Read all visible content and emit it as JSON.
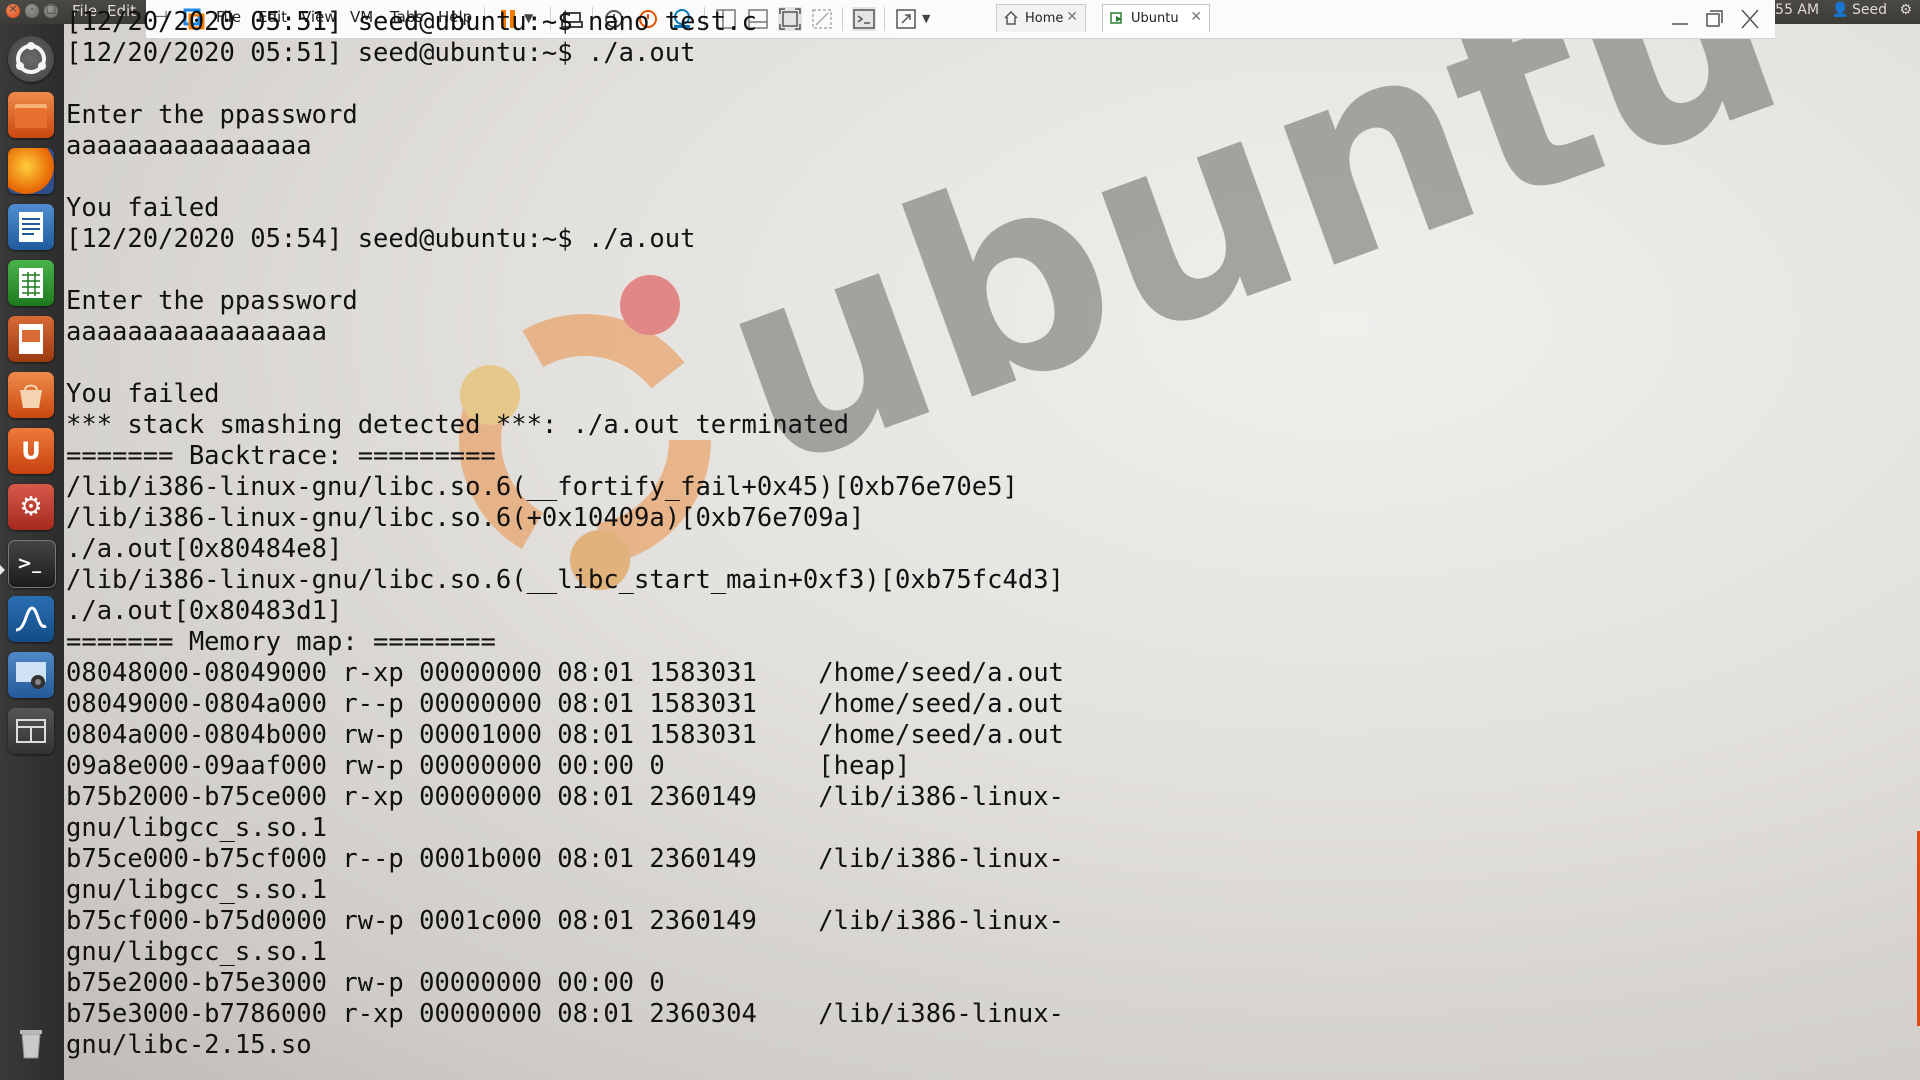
{
  "unity_panel": {
    "menus": [
      "File",
      "Edit"
    ],
    "clock": "55 AM",
    "user": "Seed"
  },
  "vmware": {
    "menus": [
      "File",
      "Edit",
      "View",
      "VM",
      "Tabs",
      "Help"
    ],
    "tabs": [
      {
        "label": "Home",
        "icon": "home-icon",
        "active": false
      },
      {
        "label": "Ubuntu",
        "icon": "vm-icon",
        "active": true
      }
    ]
  },
  "launcher": {
    "items": [
      {
        "name": "dash-home-icon"
      },
      {
        "name": "files-icon"
      },
      {
        "name": "firefox-icon"
      },
      {
        "name": "libreoffice-writer-icon"
      },
      {
        "name": "libreoffice-calc-icon"
      },
      {
        "name": "libreoffice-impress-icon"
      },
      {
        "name": "software-center-icon"
      },
      {
        "name": "ubuntu-one-icon"
      },
      {
        "name": "system-settings-icon"
      },
      {
        "name": "terminal-icon"
      },
      {
        "name": "wireshark-icon"
      },
      {
        "name": "screenshot-icon"
      },
      {
        "name": "workspace-switcher-icon"
      },
      {
        "name": "trash-icon"
      }
    ]
  },
  "wallpaper": {
    "text": "ubuntu"
  },
  "terminal": {
    "lines": [
      "[12/20/2020 05:51] seed@ubuntu:~$ nano test.c",
      "[12/20/2020 05:51] seed@ubuntu:~$ ./a.out",
      "",
      "Enter the ppassword",
      "aaaaaaaaaaaaaaaa",
      "",
      "You failed",
      "[12/20/2020 05:54] seed@ubuntu:~$ ./a.out",
      "",
      "Enter the ppassword",
      "aaaaaaaaaaaaaaaaa",
      "",
      "You failed",
      "*** stack smashing detected ***: ./a.out terminated",
      "======= Backtrace: =========",
      "/lib/i386-linux-gnu/libc.so.6(__fortify_fail+0x45)[0xb76e70e5]",
      "/lib/i386-linux-gnu/libc.so.6(+0x10409a)[0xb76e709a]",
      "./a.out[0x80484e8]",
      "/lib/i386-linux-gnu/libc.so.6(__libc_start_main+0xf3)[0xb75fc4d3]",
      "./a.out[0x80483d1]",
      "======= Memory map: ========",
      "08048000-08049000 r-xp 00000000 08:01 1583031    /home/seed/a.out",
      "08049000-0804a000 r--p 00000000 08:01 1583031    /home/seed/a.out",
      "0804a000-0804b000 rw-p 00001000 08:01 1583031    /home/seed/a.out",
      "09a8e000-09aaf000 rw-p 00000000 00:00 0          [heap]",
      "b75b2000-b75ce000 r-xp 00000000 08:01 2360149    /lib/i386-linux-",
      "gnu/libgcc_s.so.1",
      "b75ce000-b75cf000 r--p 0001b000 08:01 2360149    /lib/i386-linux-",
      "gnu/libgcc_s.so.1",
      "b75cf000-b75d0000 rw-p 0001c000 08:01 2360149    /lib/i386-linux-",
      "gnu/libgcc_s.so.1",
      "b75e2000-b75e3000 rw-p 00000000 00:00 0",
      "b75e3000-b7786000 r-xp 00000000 08:01 2360304    /lib/i386-linux-",
      "gnu/libc-2.15.so"
    ]
  }
}
